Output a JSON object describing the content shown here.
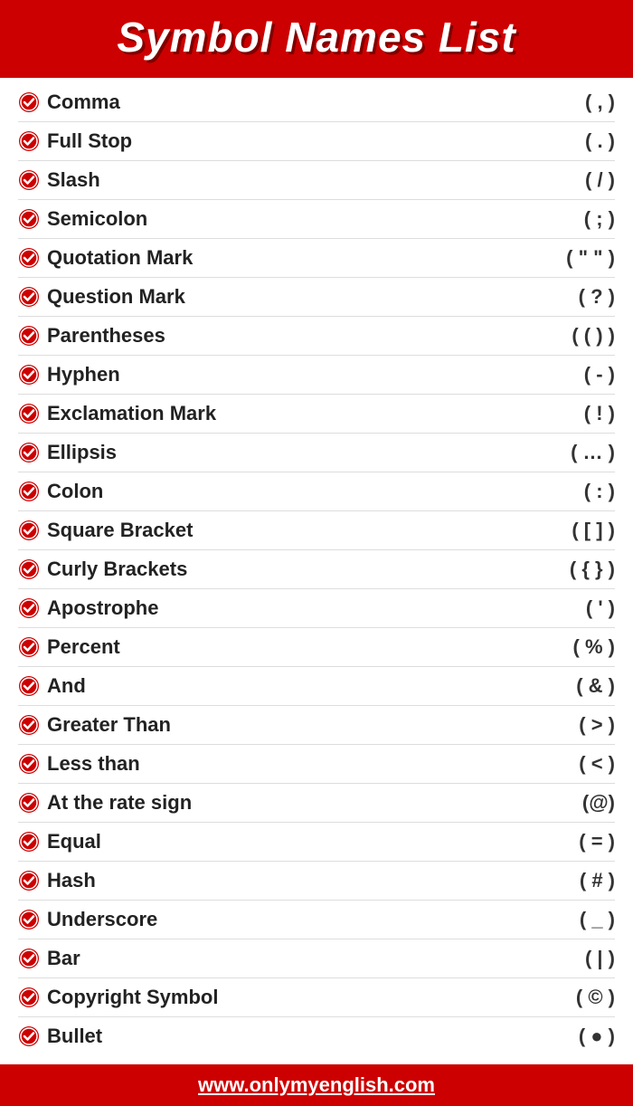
{
  "header": {
    "title": "Symbol Names List"
  },
  "symbols": [
    {
      "name": "Comma",
      "value": "( , )"
    },
    {
      "name": "Full Stop",
      "value": "( . )"
    },
    {
      "name": "Slash",
      "value": "( / )"
    },
    {
      "name": "Semicolon",
      "value": "( ; )"
    },
    {
      "name": "Quotation Mark",
      "value": "( \" \" )"
    },
    {
      "name": "Question Mark",
      "value": "( ? )"
    },
    {
      "name": "Parentheses",
      "value": "( ( ) )"
    },
    {
      "name": "Hyphen",
      "value": "( - )"
    },
    {
      "name": "Exclamation Mark",
      "value": "( ! )"
    },
    {
      "name": "Ellipsis",
      "value": "( … )"
    },
    {
      "name": "Colon",
      "value": "( : )"
    },
    {
      "name": "Square Bracket",
      "value": "( [ ] )"
    },
    {
      "name": "Curly Brackets",
      "value": "( { } )"
    },
    {
      "name": "Apostrophe",
      "value": "( ' )"
    },
    {
      "name": "Percent",
      "value": "( % )"
    },
    {
      "name": "And",
      "value": "( & )"
    },
    {
      "name": "Greater Than",
      "value": "( > )"
    },
    {
      "name": "Less than",
      "value": "( < )"
    },
    {
      "name": "At the rate sign",
      "value": "(@)"
    },
    {
      "name": "Equal",
      "value": "( = )"
    },
    {
      "name": "Hash",
      "value": "( # )"
    },
    {
      "name": "Underscore",
      "value": "( _ )"
    },
    {
      "name": "Bar",
      "value": "( | )"
    },
    {
      "name": "Copyright Symbol",
      "value": "( © )"
    },
    {
      "name": "Bullet",
      "value": "( ● )"
    }
  ],
  "footer": {
    "url": "www.onlymyenglish.com"
  }
}
